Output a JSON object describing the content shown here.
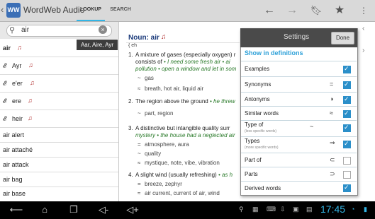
{
  "app": {
    "title": "WordWeb Audio",
    "icon": "WW",
    "back_icon": "chevron-left-icon"
  },
  "tabs": [
    {
      "label": "LOOKUP"
    },
    {
      "label": "SEARCH"
    }
  ],
  "toolbar": {
    "icons": [
      "back-arrow-icon",
      "forward-arrow-icon",
      "bookmark-add-icon",
      "star-icon",
      "overflow-menu-icon"
    ]
  },
  "search": {
    "value": "air",
    "placeholder": ""
  },
  "tooltip": {
    "text": "Aar, Aire, Ayr"
  },
  "word_list": [
    {
      "word": "air",
      "has_note": true,
      "audio": false
    },
    {
      "word": "Ayr",
      "has_note": true,
      "audio": true
    },
    {
      "word": "e'er",
      "has_note": true,
      "audio": true
    },
    {
      "word": "ere",
      "has_note": true,
      "audio": true
    },
    {
      "word": "heir",
      "has_note": true,
      "audio": true
    },
    {
      "word": "air alert",
      "has_note": false,
      "audio": false
    },
    {
      "word": "air attaché",
      "has_note": false,
      "audio": false
    },
    {
      "word": "air attack",
      "has_note": false,
      "audio": false
    },
    {
      "word": "air bag",
      "has_note": false,
      "audio": false
    },
    {
      "word": "air base",
      "has_note": false,
      "audio": false
    }
  ],
  "entry": {
    "heading": "Noun: air",
    "ipa": "{ eh",
    "senses": [
      {
        "num": "1.",
        "text": "A mixture of gases (especially oxygen) r",
        "line2": "consists of",
        "ex": "• I need some fresh air • ai",
        "ex2": "pollution • open a window and let in som",
        "rels": [
          {
            "sym": "~",
            "text": "gas"
          },
          {
            "sym": "≈",
            "text": "breath, hot air, liquid air"
          }
        ]
      },
      {
        "num": "2.",
        "text": "The region above the ground",
        "ex": "• he threw",
        "rels": [
          {
            "sym": "~",
            "text": "part, region"
          }
        ]
      },
      {
        "num": "3.",
        "text": "A distinctive but intangible quality surr",
        "ex2": "mystery • the house had a neglected air",
        "rels": [
          {
            "sym": "=",
            "text": "atmosphere, aura"
          },
          {
            "sym": "~",
            "text": "quality"
          },
          {
            "sym": "≈",
            "text": "mystique, note, vibe, vibration"
          }
        ]
      },
      {
        "num": "4.",
        "text": "A slight wind (usually refreshing)",
        "ex": "• as h",
        "rels": [
          {
            "sym": "=",
            "text": "breeze, zephyr"
          },
          {
            "sym": "≈",
            "text": "air current, current of air, wind"
          }
        ]
      }
    ]
  },
  "settings": {
    "title": "Settings",
    "done": "Done",
    "section": "Show in definitions",
    "rows": [
      {
        "label": "Examples",
        "sub": "",
        "symbol": "",
        "checked": true
      },
      {
        "label": "Synonyms",
        "sub": "",
        "symbol": "=",
        "checked": true
      },
      {
        "label": "Antonyms",
        "sub": "",
        "symbol": "◑",
        "checked": true
      },
      {
        "label": "Similar words",
        "sub": "",
        "symbol": "≈",
        "checked": true
      },
      {
        "label": "Type of",
        "sub": "(less specific words)",
        "symbol": "~",
        "checked": true
      },
      {
        "label": "Types",
        "sub": "(more specific words)",
        "symbol": "⇒",
        "checked": true
      },
      {
        "label": "Part of",
        "sub": "",
        "symbol": "⊂",
        "checked": false
      },
      {
        "label": "Parts",
        "sub": "",
        "symbol": "⊃",
        "checked": false
      },
      {
        "label": "Derived words",
        "sub": "",
        "symbol": "",
        "checked": true
      }
    ]
  },
  "statusbar": {
    "clock": "17:45"
  },
  "colors": {
    "accent": "#33b5e5",
    "note": "#b13030",
    "example": "#2a7a2a"
  }
}
